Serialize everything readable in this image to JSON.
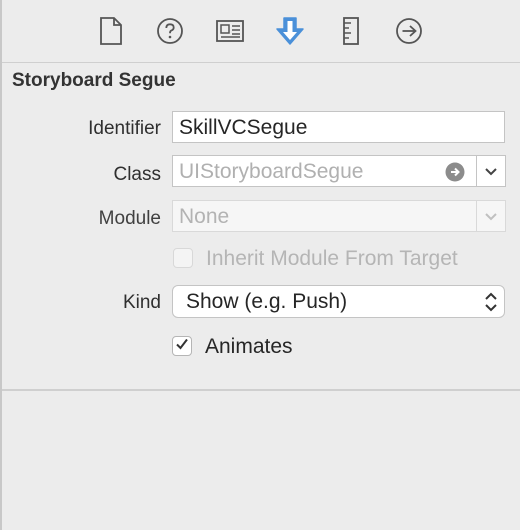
{
  "toolbar": {
    "icons": [
      "file-icon",
      "help-icon",
      "identity-card-icon",
      "attributes-arrow-icon",
      "ruler-icon",
      "connections-arrow-icon"
    ],
    "selected_index": 3,
    "accent_color": "#4a90d9"
  },
  "section": {
    "title": "Storyboard Segue"
  },
  "form": {
    "identifier": {
      "label": "Identifier",
      "value": "SkillVCSegue"
    },
    "class": {
      "label": "Class",
      "placeholder": "UIStoryboardSegue"
    },
    "module": {
      "label": "Module",
      "placeholder": "None"
    },
    "inherit_module": {
      "label": "Inherit Module From Target",
      "checked": false,
      "enabled": false
    },
    "kind": {
      "label": "Kind",
      "value": "Show (e.g. Push)"
    },
    "animates": {
      "label": "Animates",
      "checked": true
    }
  }
}
